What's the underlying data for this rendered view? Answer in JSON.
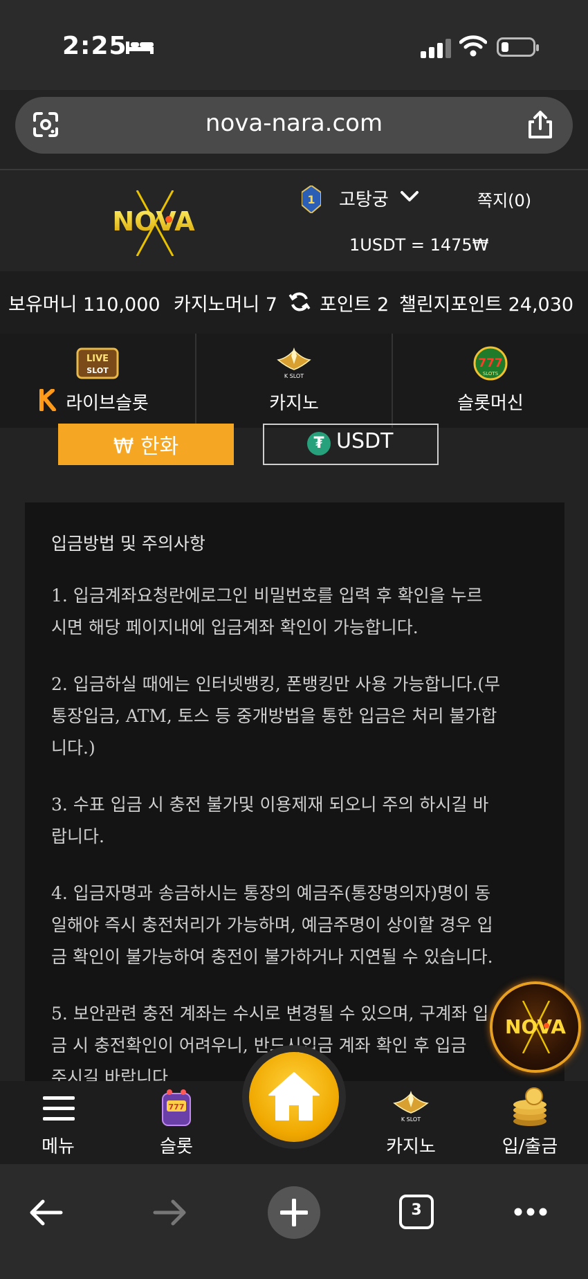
{
  "status_bar": {
    "time": "2:25"
  },
  "browser": {
    "url": "nova-nara.com",
    "tab_count": "3"
  },
  "site": {
    "logo_text": "NOVA",
    "username": "고탕궁",
    "messages": "쪽지(0)",
    "exchange_rate": "1USDT = 1475₩"
  },
  "balance": {
    "held_money": "보유머니 110,000",
    "casino_money": "카지노머니 7",
    "points": "포인트 2",
    "challenge_points": "챌린지포인트 24,030"
  },
  "categories": [
    {
      "label": "라이브슬롯",
      "icon": "live-slot-icon"
    },
    {
      "label": "카지노",
      "icon": "k-slot-icon"
    },
    {
      "label": "슬롯머신",
      "icon": "slots-777-icon"
    }
  ],
  "currency_tabs": {
    "krw": "₩ 한화",
    "usdt": "USDT",
    "active": "krw"
  },
  "notice": {
    "title": "입금방법 및 주의사항",
    "paragraphs": [
      [
        "1. 입금계좌요청란에로그인 비밀번호를 입력 후 확인을 누르",
        "시면 해당 페이지내에 입금계좌 확인이 가능합니다."
      ],
      [
        "2. 입금하실 때에는 인터넷뱅킹, 폰뱅킹만 사용 가능합니다.(무",
        "통장입금, ATM, 토스 등 중개방법을 통한 입금은 처리 불가합",
        "니다.)"
      ],
      [
        "3. 수표 입금 시 충전 불가및 이용제재 되오니 주의 하시길 바",
        "랍니다."
      ],
      [
        "4. 입금자명과 송금하시는 통장의 예금주(통장명의자)명이 동",
        "일해야 즉시 충전처리가 가능하며, 예금주명이 상이할 경우 입",
        "금 확인이 불가능하여 충전이 불가하거나 지연될 수 있습니다."
      ],
      [
        "5. 보안관련 충전 계좌는 수시로 변경될 수 있으며, 구계좌 입",
        "금 시 충전확인이 어려우니, 반드시입금 계좌 확인 후 입금",
        "주시길 바랍니다."
      ]
    ]
  },
  "bottom_nav": {
    "menu": "메뉴",
    "slot": "슬롯",
    "casino": "카지노",
    "deposit": "입/출금"
  },
  "colors": {
    "accent": "#f5a623",
    "usdt": "#26a17b",
    "background": "#232323"
  }
}
